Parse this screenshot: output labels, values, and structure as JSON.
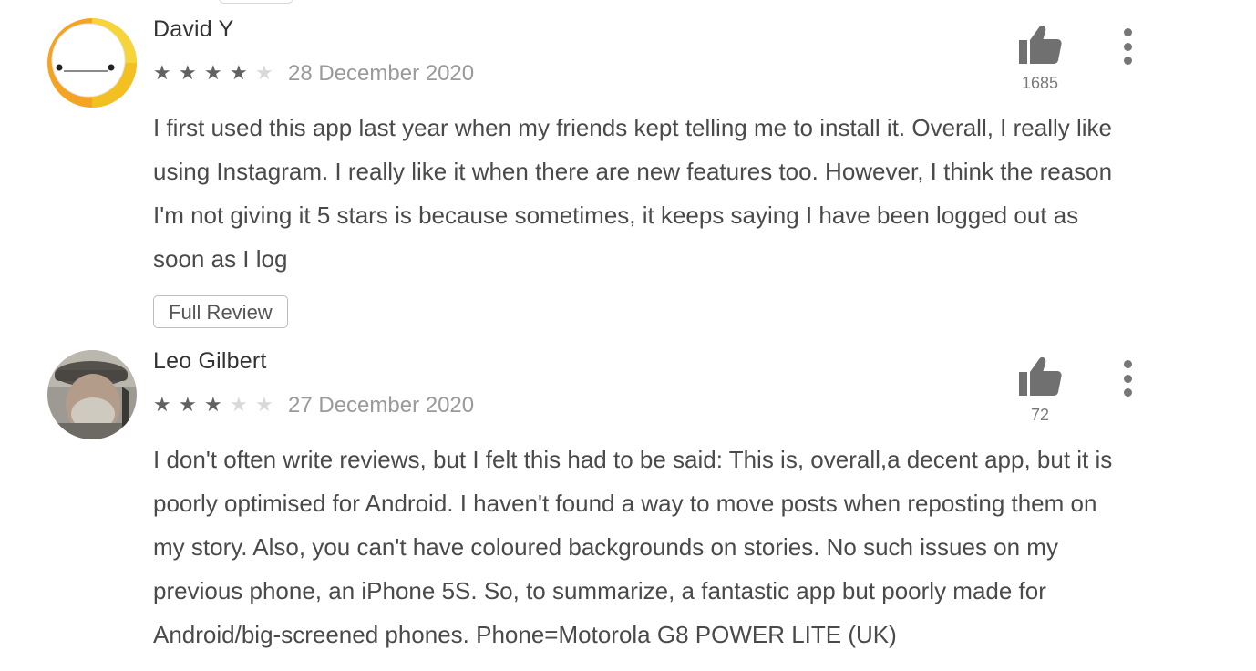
{
  "reviews": [
    {
      "author": "David Y",
      "rating": 4,
      "max_rating": 5,
      "date": "28 December 2020",
      "likes": "1685",
      "body_lines": [
        "I first used this app last year when my friends kept telling me to install it. Overall, I really like",
        "using Instagram. I really like it when there are new features too. However, I think the reason",
        "I'm not giving it 5 stars is because sometimes, it keeps saying I have been logged out as",
        "soon as I log"
      ],
      "full_review_label": "Full Review",
      "avatar_icon": "cartoon-face-avatar"
    },
    {
      "author": "Leo Gilbert",
      "rating": 3,
      "max_rating": 5,
      "date": "27 December 2020",
      "likes": "72",
      "body_lines": [
        "I don't often write reviews, but I felt this had to be said: This is, overall,a decent app, but it is",
        "poorly optimised for Android. I haven't found a way to move posts when reposting them on",
        "my story. Also, you can't have coloured backgrounds on stories. No such issues on my",
        "previous phone, an iPhone 5S. So, to summarize, a fantastic app but poorly made for",
        "Android/big-screened phones. Phone=Motorola G8 POWER LITE (UK)"
      ],
      "avatar_icon": "photo-avatar"
    }
  ],
  "icons": {
    "thumb": "thumbs-up-icon",
    "more": "more-vert-icon",
    "star": "star-icon"
  },
  "colors": {
    "star_filled": "#616161",
    "star_empty": "#d9d9d9",
    "date": "#9a9a9a",
    "icon": "#757575"
  }
}
